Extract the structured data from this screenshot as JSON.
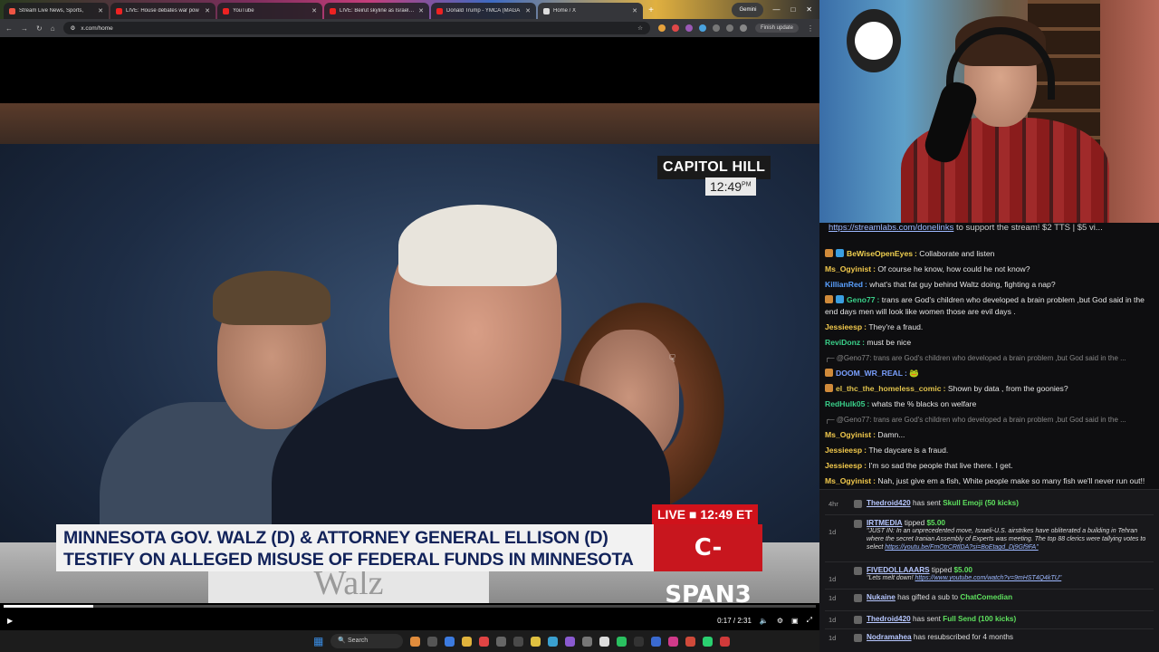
{
  "browser": {
    "tabs": [
      {
        "title": "Stream Live News, Sports,",
        "color": "#e54"
      },
      {
        "title": "LIVE: House debates war pow",
        "color": "#e22"
      },
      {
        "title": "YouTube",
        "color": "#e22"
      },
      {
        "title": "LIVE: Beirut skyline as Israel bo",
        "color": "#e22"
      },
      {
        "title": "Donald Trump - YMCA (MAGA",
        "color": "#e22"
      },
      {
        "title": "Home / X",
        "color": "#ddd"
      }
    ],
    "new_tab": "+",
    "gemini_label": "Gemini",
    "url": "x.com/home",
    "finish_update": "Finish update"
  },
  "video": {
    "location": "CAPITOL HILL",
    "time": "12:49",
    "time_suffix": "PM",
    "live_label": "LIVE ■ 12:49 ET",
    "headline_line1": "MINNESOTA GOV. WALZ (D) & ATTORNEY GENERAL ELLISON (D)",
    "headline_line2": "TESTIFY ON ALLEGED MISUSE OF FEDERAL FUNDS IN MINNESOTA",
    "network": "C-SPAN3",
    "nameplate": "Walz",
    "elapsed": "0:17 / 2:31",
    "progress": 0.11
  },
  "taskbar": {
    "search_label": "Search"
  },
  "chat": {
    "pinned_link": "https://streamlabs.com/donelinks",
    "pinned_text": " to support the stream! $2 TTS | $5 vi...",
    "messages": [
      {
        "user": "BeWiseOpenEyes",
        "color": "#f0d050",
        "text": "Collaborate and listen",
        "badges": 2
      },
      {
        "user": "Ms_Ogyinist",
        "color": "#f2c94c",
        "text": "Of course he know, how could he not know?",
        "badges": 0
      },
      {
        "user": "KillianRed",
        "color": "#5aa0ff",
        "text": "what's that fat guy behind Waltz doing, fighting a nap?",
        "badges": 0
      },
      {
        "user": "Geno77",
        "color": "#3ad08a",
        "text": "trans are God's children who developed a brain problem ,but God said in the end days men will look like women those are evil days .",
        "badges": 2,
        "wrap": true
      },
      {
        "user": "Jessieesp",
        "color": "#f2c94c",
        "text": "They're a fraud.",
        "badges": 0
      },
      {
        "user": "ReviDonz",
        "color": "#3ad08a",
        "text": "must be nice",
        "badges": 0
      },
      {
        "user": "",
        "color": "#888",
        "text": "@Geno77: trans are God's children who developed a brain problem ,but God said in the ...",
        "reply": true
      },
      {
        "user": "DOOM_WR_REAL",
        "color": "#7aa0ff",
        "text": "",
        "badges": 1
      },
      {
        "user": "el_thc_the_homeless_comic",
        "color": "#e0c24c",
        "text": "Shown by data , from the goonies?",
        "badges": 1
      },
      {
        "user": "RedHulk05",
        "color": "#3ad08a",
        "text": "whats the % blacks on welfare",
        "badges": 0
      },
      {
        "user": "",
        "color": "#888",
        "text": "@Geno77: trans are God's children who developed a brain problem ,but God said in the ...",
        "reply": true
      },
      {
        "user": "Ms_Ogyinist",
        "color": "#f2c94c",
        "text": "Damn...",
        "badges": 0
      },
      {
        "user": "Jessieesp",
        "color": "#f2c94c",
        "text": "The daycare is a fraud.",
        "badges": 0
      },
      {
        "user": "Jessieesp",
        "color": "#f2c94c",
        "text": "I'm so sad the people that live there. I get.",
        "badges": 0
      },
      {
        "user": "Ms_Ogyinist",
        "color": "#f2c94c",
        "text": "Nah, just give em a fish, White people make so many fish we'll never run out!!",
        "badges": 0
      }
    ]
  },
  "events": [
    {
      "age": "4hr",
      "user": "Thedroid420",
      "mid": " has sent ",
      "hl": "Skull Emoji (50 kicks)",
      "sub": "",
      "sub_link": ""
    },
    {
      "age": "1d",
      "user": "IRTMEDIA",
      "mid": " tipped ",
      "hl": "$5.00",
      "sub": "\"JUST IN: In an unprecedented move, Israeli-U.S. airstrikes have obliterated a building in Tehran where the secret Iranian Assembly of Experts was meeting. The top 88 clerics were tallying votes to select ",
      "sub_link": "https://youtu.be/FmOtrCRtlDA?si=BoEtagd_Dj9Gf9FA\""
    },
    {
      "age": "1d",
      "user": "FIVEDOLLAAARS",
      "mid": " tipped ",
      "hl": "$5.00",
      "sub": "\"Lets melt down! ",
      "sub_link": "https://www.youtube.com/watch?v=9mHST4Q4kTU\""
    },
    {
      "age": "1d",
      "user": "Nukaine",
      "mid": " has gifted a sub to ",
      "hl": "ChatComedian",
      "sub": "",
      "sub_link": ""
    },
    {
      "age": "1d",
      "user": "Thedroid420",
      "mid": " has sent ",
      "hl": "Full Send (100 kicks)",
      "sub": "",
      "sub_link": ""
    },
    {
      "age": "1d",
      "user": "Nodramahea",
      "mid": " has resubscribed for 4 months",
      "hl": "",
      "sub": "",
      "sub_link": ""
    }
  ]
}
